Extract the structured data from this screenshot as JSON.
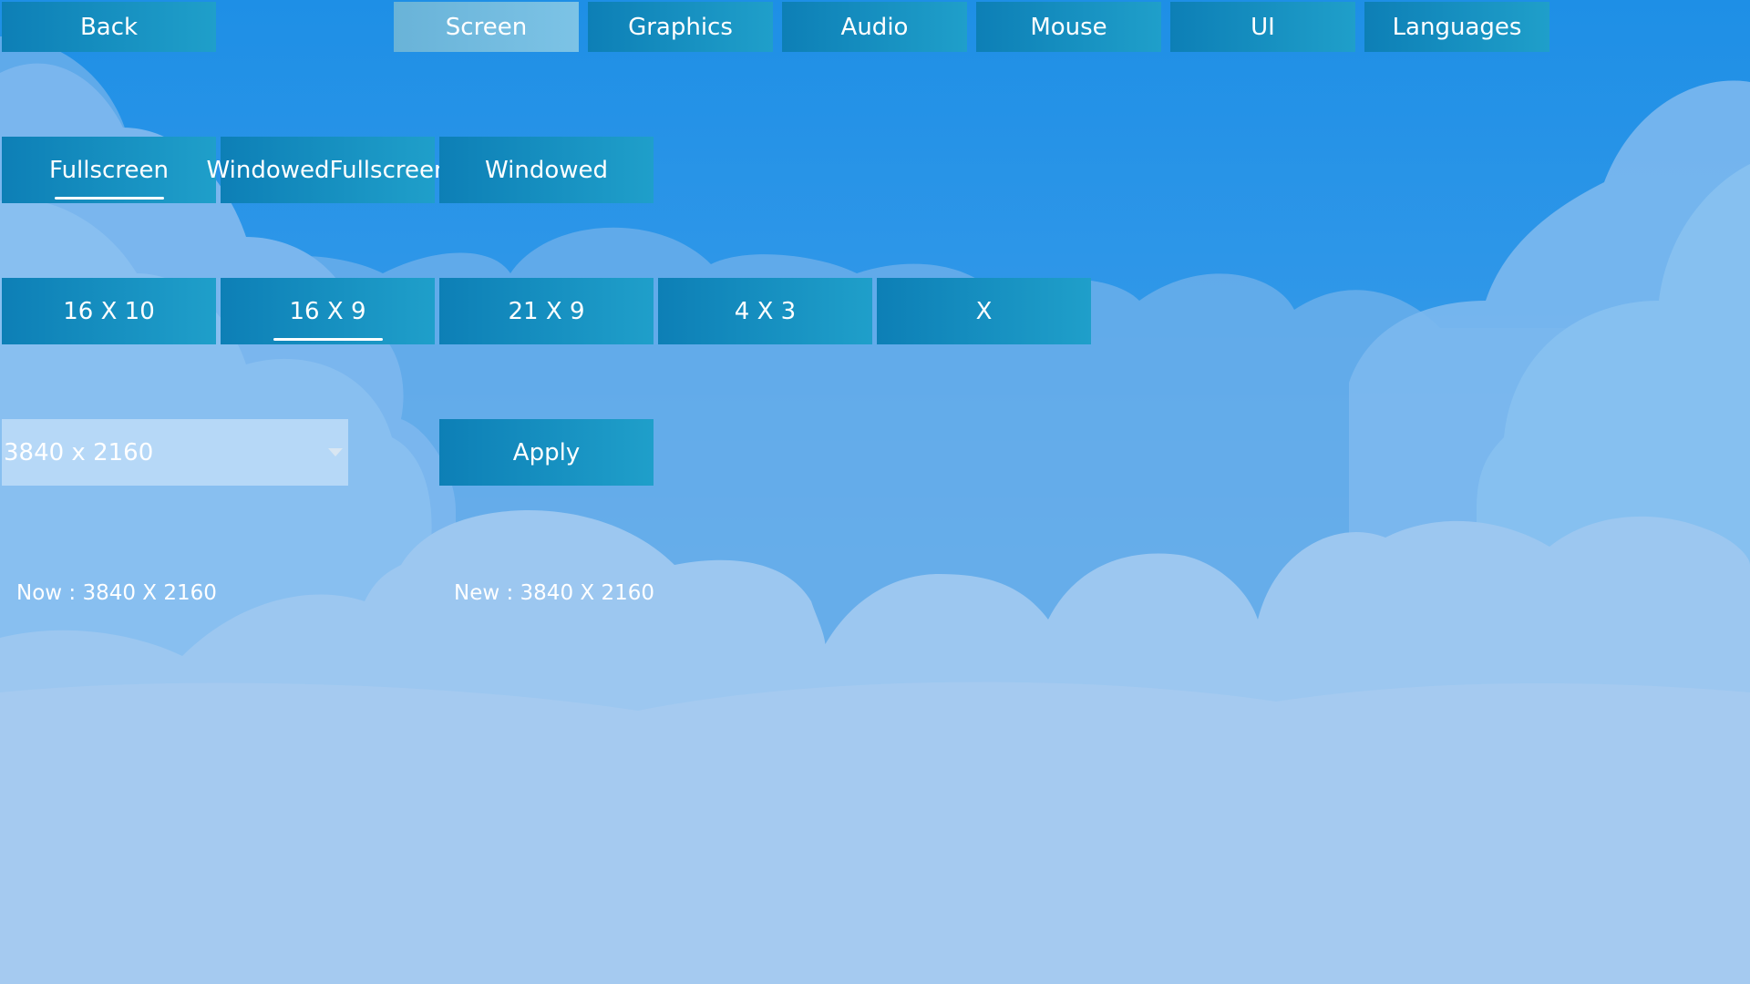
{
  "nav": {
    "back": "Back",
    "tabs": [
      "Screen",
      "Graphics",
      "Audio",
      "Mouse",
      "UI",
      "Languages"
    ],
    "active_tab": "Screen"
  },
  "display_mode": {
    "options": [
      "Fullscreen",
      "WindowedFullscreen",
      "Windowed"
    ],
    "selected": "Fullscreen"
  },
  "aspect_ratio": {
    "options": [
      "16 X 10",
      "16 X 9",
      "21 X 9",
      "4 X 3",
      "X"
    ],
    "selected": "16 X 9"
  },
  "resolution": {
    "selected_value": "3840 x 2160"
  },
  "apply_label": "Apply",
  "status": {
    "now": "Now : 3840 X 2160",
    "new": "New : 3840 X 2160"
  },
  "colors": {
    "button_start": "#0d7fb6",
    "button_end": "#1f9fca",
    "active_tab": "#74bbe0",
    "sky": "#1e8fe6",
    "cloud": "#a3c9f0"
  }
}
